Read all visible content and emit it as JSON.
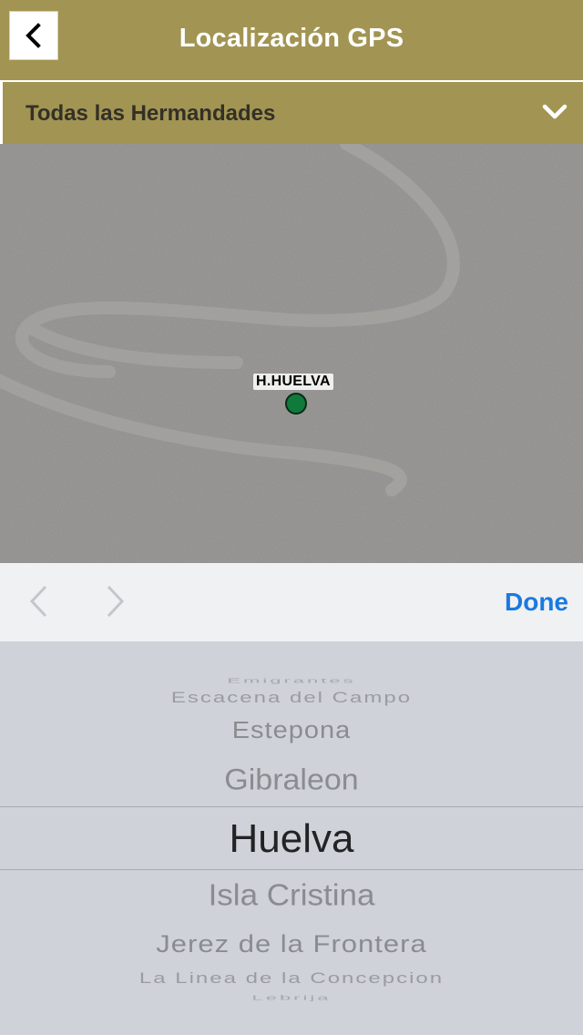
{
  "header": {
    "title": "Localización GPS",
    "back_icon": "chevron-left-icon"
  },
  "filter": {
    "label": "Todas las Hermandades",
    "icon": "chevron-down-icon"
  },
  "map": {
    "marker_label": "H.HUELVA",
    "marker_color": "#0f7a3c"
  },
  "toolbar": {
    "done_label": "Done",
    "prev_icon": "chevron-left-icon",
    "next_icon": "chevron-right-icon"
  },
  "picker": {
    "selected": "Huelva",
    "items": [
      "Emigrantes",
      "Escacena del Campo",
      "Estepona",
      "Gibraleon",
      "Huelva",
      "Isla Cristina",
      "Jerez de la Frontera",
      "La Linea de la Concepcion",
      "Lebrija"
    ]
  },
  "colors": {
    "nav": "#a29452",
    "accent": "#1a7ae0"
  }
}
